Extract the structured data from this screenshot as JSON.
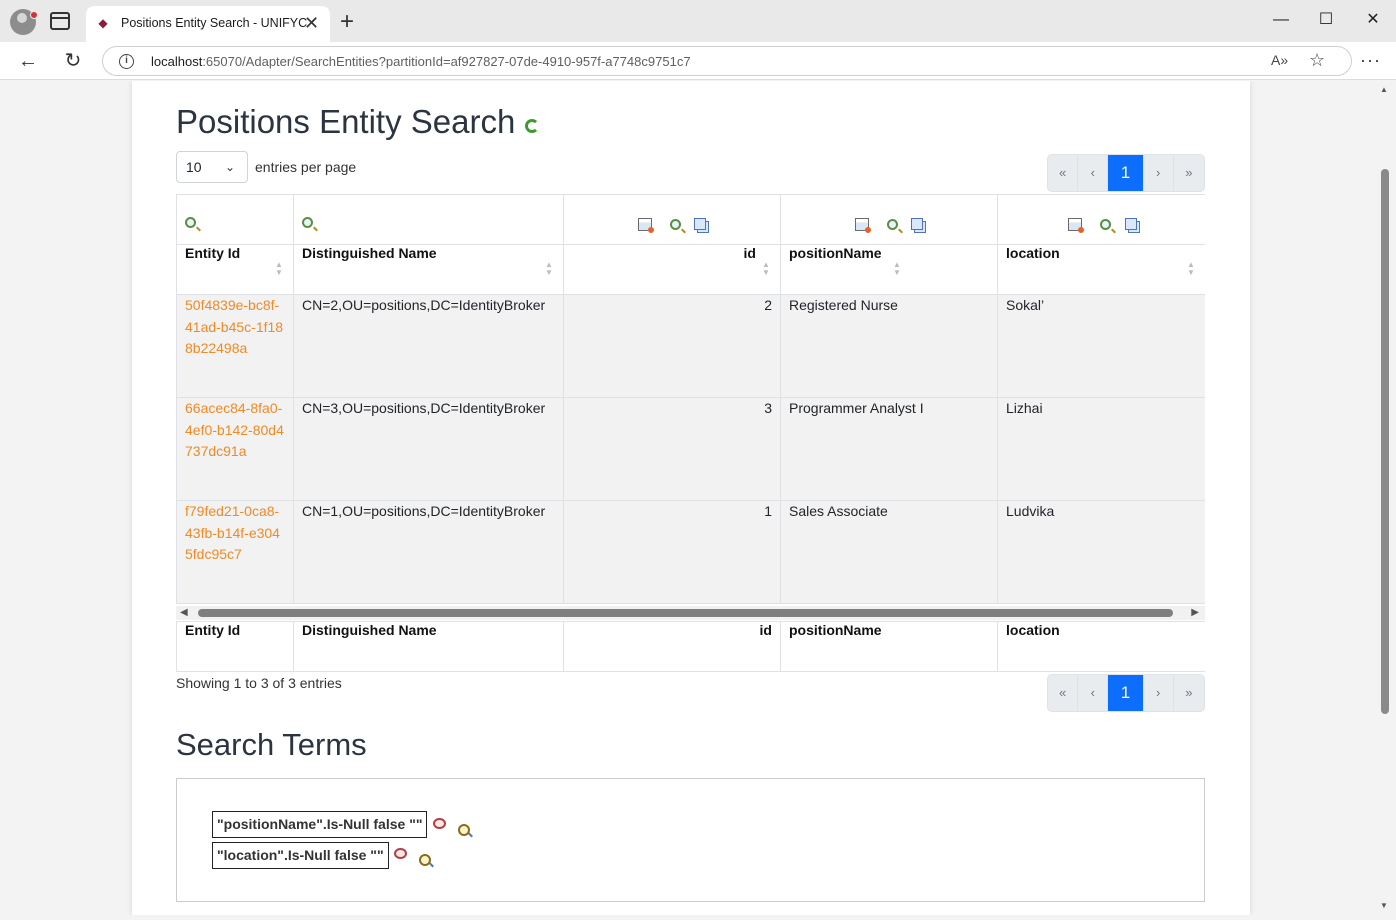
{
  "browser": {
    "tab_title": "Positions Entity Search - UNIFYCo",
    "url_host": "localhost",
    "url_rest": ":65070/Adapter/SearchEntities?partitionId=af927827-07de-4910-957f-a7748c9751c7",
    "new_tab_label": "+",
    "tab_close_label": "✕",
    "back_label": "←",
    "reload_label": "↻",
    "minimize_label": "—",
    "maximize_label": "☐",
    "close_label": "✕",
    "read_aloud_label": "A»",
    "favorite_label": "☆",
    "more_label": "···",
    "info_label": "i"
  },
  "page": {
    "title": "Positions Entity Search",
    "page_length": "10",
    "page_length_suffix": "entries per page",
    "pager": {
      "first": "«",
      "prev": "‹",
      "current": "1",
      "next": "›",
      "last": "»"
    },
    "info": "Showing 1 to 3 of 3 entries"
  },
  "table": {
    "columns": [
      "Entity Id",
      "Distinguished Name",
      "id",
      "positionName",
      "location"
    ],
    "rows": [
      {
        "entity_id": "50f4839e-bc8f-41ad-b45c-1f188b22498a",
        "dn": "CN=2,OU=positions,DC=IdentityBroker",
        "id": "2",
        "positionName": "Registered Nurse",
        "location": "Sokal’"
      },
      {
        "entity_id": "66acec84-8fa0-4ef0-b142-80d4737dc91a",
        "dn": "CN=3,OU=positions,DC=IdentityBroker",
        "id": "3",
        "positionName": "Programmer Analyst I",
        "location": "Lizhai"
      },
      {
        "entity_id": "f79fed21-0ca8-43fb-b14f-e3045fdc95c7",
        "dn": "CN=1,OU=positions,DC=IdentityBroker",
        "id": "1",
        "positionName": "Sales Associate",
        "location": "Ludvika"
      }
    ]
  },
  "search_terms": {
    "title": "Search Terms",
    "terms": [
      "\"positionName\".Is-Null false \"\"",
      "\"location\".Is-Null false \"\""
    ]
  },
  "icons": {
    "sort": "sort-icon",
    "filter": "magnifier-plus-icon",
    "column_settings": "table-settings-icon",
    "copy": "copy-icon",
    "remove_term": "magnifier-remove-icon",
    "find_term": "magnifier-find-icon",
    "refresh": "refresh-icon"
  },
  "colors": {
    "link": "#ef8a25",
    "pager_active": "#0d6efd",
    "row_bg": "#f2f2f2"
  }
}
